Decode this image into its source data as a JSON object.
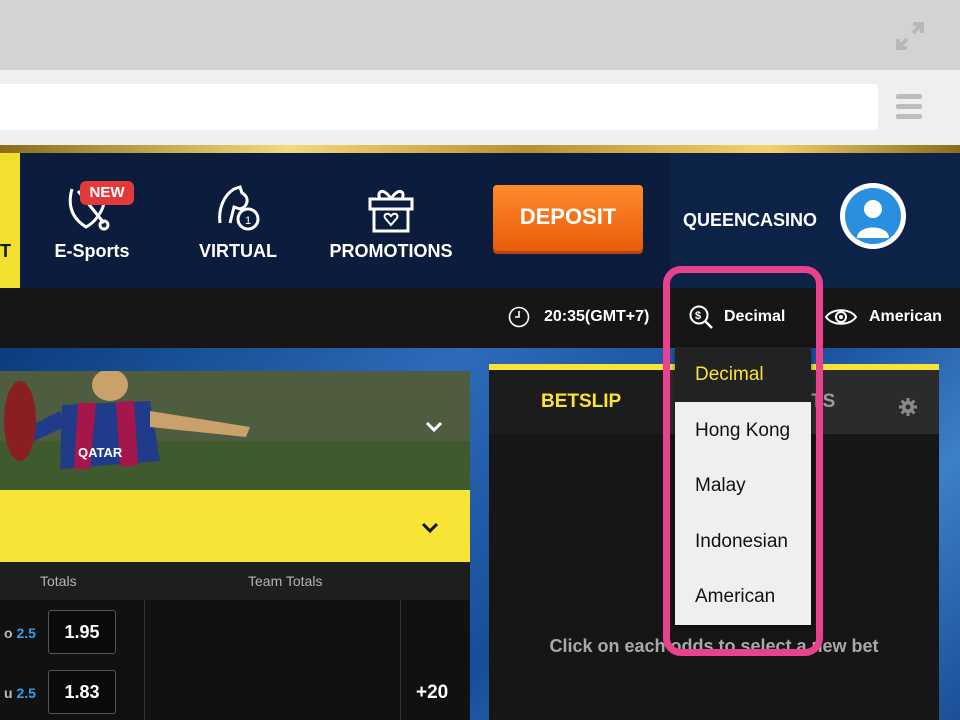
{
  "nav": {
    "left_tab_letter": "T",
    "esports_label": "E-Sports",
    "new_badge": "NEW",
    "virtual_label": "VIRTUAL",
    "promotions_label": "PROMOTIONS",
    "deposit_label": "DEPOSIT",
    "username": "QUEENCASINO"
  },
  "info_bar": {
    "time": "20:35(GMT+7)",
    "odds_format": "Decimal",
    "view_mode": "American"
  },
  "dropdown": {
    "options": [
      "Decimal",
      "Hong Kong",
      "Malay",
      "Indonesian",
      "American"
    ],
    "selected": "Decimal"
  },
  "table": {
    "headers": [
      "Totals",
      "Team Totals"
    ],
    "rows": [
      {
        "side": "o",
        "line": "2.5",
        "odds": "1.95"
      },
      {
        "side": "u",
        "line": "2.5",
        "odds": "1.83"
      }
    ],
    "more_count": "+20"
  },
  "betslip": {
    "tab_betslip": "BETSLIP",
    "tab_mybets_partial": "TS",
    "empty_message": "Click on each odds to select a new bet"
  },
  "hero": {
    "jersey_sponsor": "QATAR"
  },
  "colors": {
    "accent_yellow": "#f7e437",
    "deposit_orange": "#f47a1f",
    "highlight_pink": "#e8428e",
    "header_navy": "#0b1c3d"
  }
}
